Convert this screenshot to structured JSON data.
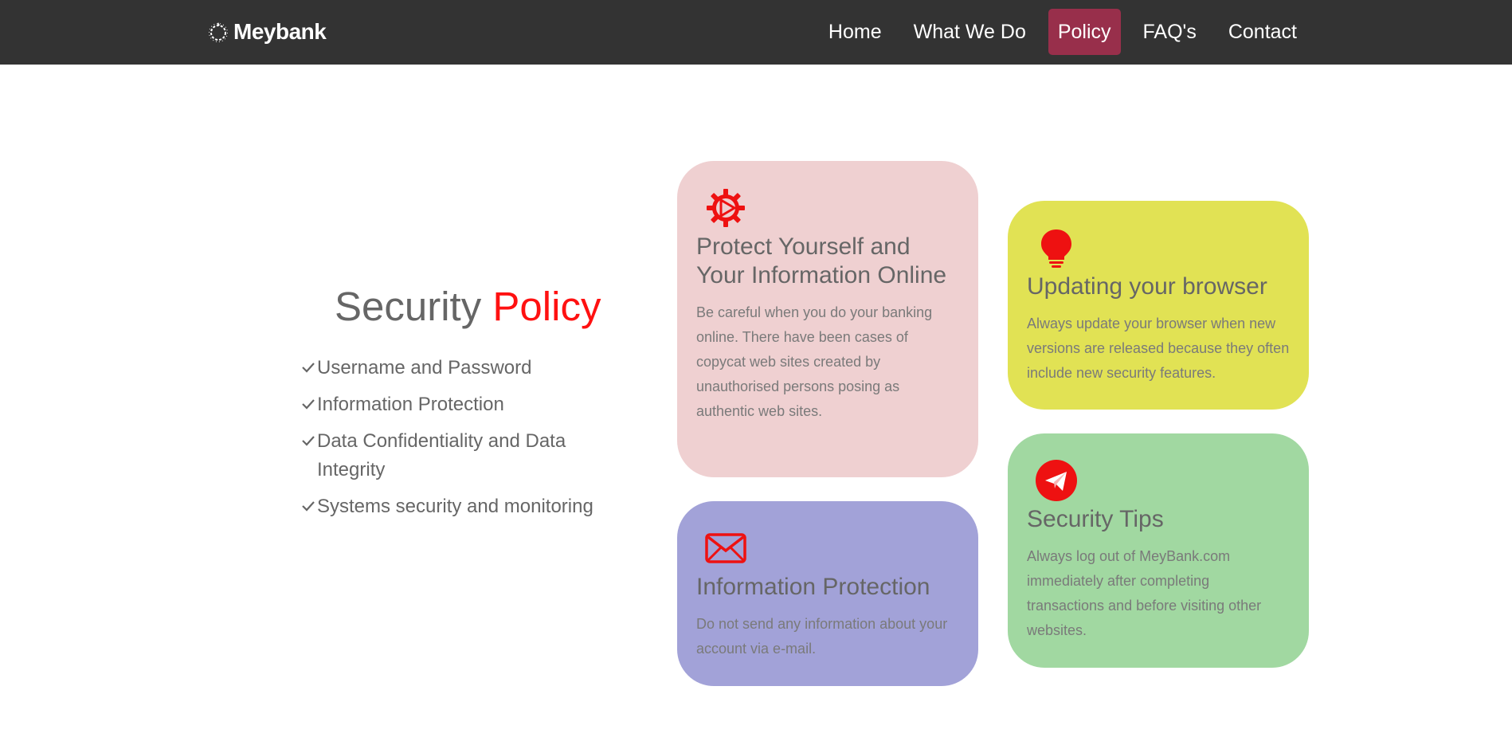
{
  "brand": {
    "name": "Meybank",
    "icon": "sunburst-logo-icon"
  },
  "nav": {
    "items": [
      {
        "label": "Home"
      },
      {
        "label": "What We Do"
      },
      {
        "label": "Policy",
        "active": true
      },
      {
        "label": "FAQ's"
      },
      {
        "label": "Contact"
      }
    ],
    "active_color": "#982f4b",
    "background": "#333333"
  },
  "section": {
    "title_prefix": "Security",
    "title_accent": "Policy",
    "accent_color": "#ff1111",
    "list": [
      "Username and Password",
      "Information Protection",
      "Data Confidentiality and Data Integrity",
      "Systems security and monitoring"
    ]
  },
  "cards": {
    "protect": {
      "icon": "gear-play-icon",
      "title": "Protect Yourself and Your Information Online",
      "text": "Be careful when you do your banking online. There have been cases of copycat web sites created by unauthorised persons posing as authentic web sites.",
      "color": "#efd0d1"
    },
    "browser": {
      "icon": "lightbulb-icon",
      "title": "Updating your browser",
      "text": "Always update your browser when new versions are released because they often include new security features.",
      "color": "#e1e254"
    },
    "info": {
      "icon": "envelope-icon",
      "title": "Information Protection",
      "text": "Do not send any information about your account via e-mail.",
      "color": "#a2a2d8"
    },
    "tips": {
      "icon": "paper-plane-icon",
      "title": "Security Tips",
      "text": "Always log out of MeyBank.com immediately after completing transactions and before visiting other websites.",
      "color": "#a1d8a1"
    }
  }
}
